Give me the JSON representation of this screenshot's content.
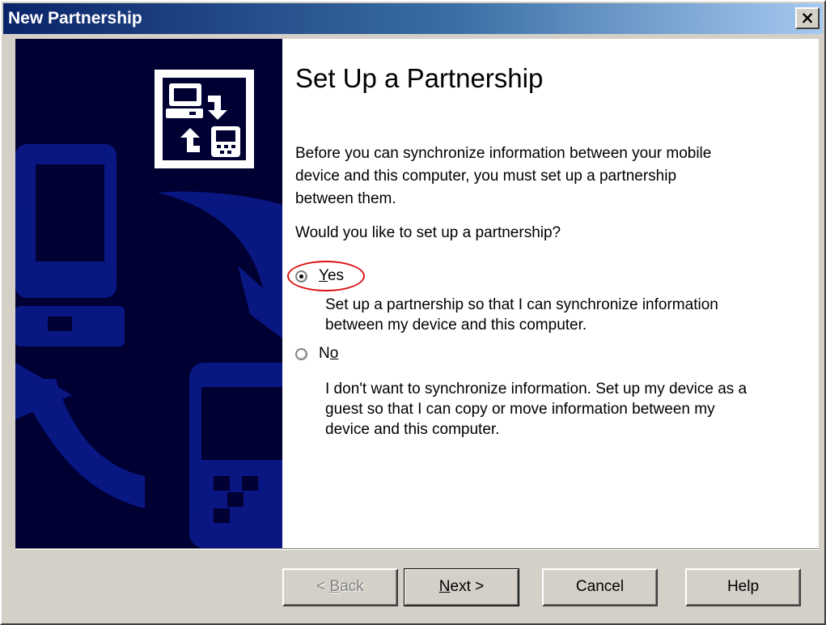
{
  "window": {
    "title": "New Partnership",
    "close_glyph": "×"
  },
  "sidebar": {
    "banner_icon": "sync-computer-device-icon"
  },
  "content": {
    "heading": "Set Up a Partnership",
    "description": "Before you can synchronize information between your mobile device and this computer, you must set up a partnership between them.",
    "question": "Would you like to set up a partnership?",
    "options": [
      {
        "label_mnemonic": "Y",
        "label_rest": "es",
        "selected": true,
        "description": "Set up a partnership so that I can synchronize information between my device and this computer."
      },
      {
        "label_pre": "N",
        "label_mnemonic": "o",
        "selected": false,
        "description": "I don't want to synchronize information. Set up my device as a guest so that I can copy or move information between my device and this computer."
      }
    ]
  },
  "buttons": {
    "back": {
      "arrow": "< ",
      "mnemonic": "B",
      "rest": "ack",
      "enabled": false
    },
    "next": {
      "mnemonic": "N",
      "rest": "ext >",
      "enabled": true
    },
    "cancel": {
      "label": "Cancel"
    },
    "help": {
      "label": "Help"
    }
  },
  "colors": {
    "titlebar_start": "#0a246a",
    "sidebar_bg": "#000033",
    "highlight": "#dd1111",
    "dialog_face": "#d4d0c8"
  }
}
